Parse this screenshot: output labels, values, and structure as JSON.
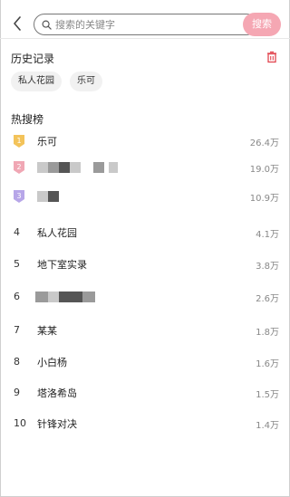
{
  "search": {
    "placeholder": "搜索的关键字",
    "button_label": "搜索"
  },
  "history": {
    "title": "历史记录",
    "tags": [
      "私人花园",
      "乐可"
    ]
  },
  "hot": {
    "title": "热搜榜",
    "items": [
      {
        "rank": "1",
        "name": "乐可",
        "count": "26.4万"
      },
      {
        "rank": "2",
        "name": "",
        "count": "19.0万"
      },
      {
        "rank": "3",
        "name": "",
        "count": "10.9万"
      },
      {
        "rank": "4",
        "name": "私人花园",
        "count": "4.1万"
      },
      {
        "rank": "5",
        "name": "地下室实录",
        "count": "3.8万"
      },
      {
        "rank": "6",
        "name": "",
        "count": "2.6万"
      },
      {
        "rank": "7",
        "name": "某某",
        "count": "1.8万"
      },
      {
        "rank": "8",
        "name": "小白杨",
        "count": "1.6万"
      },
      {
        "rank": "9",
        "name": "塔洛希岛",
        "count": "1.5万"
      },
      {
        "rank": "10",
        "name": "针锋对决",
        "count": "1.4万"
      }
    ]
  },
  "colors": {
    "accent": "#f5a7b3",
    "badge_gold": "#f3c35a",
    "badge_pink": "#f0a7b4",
    "badge_purple": "#b7a6e8",
    "trash": "#e2454f"
  }
}
